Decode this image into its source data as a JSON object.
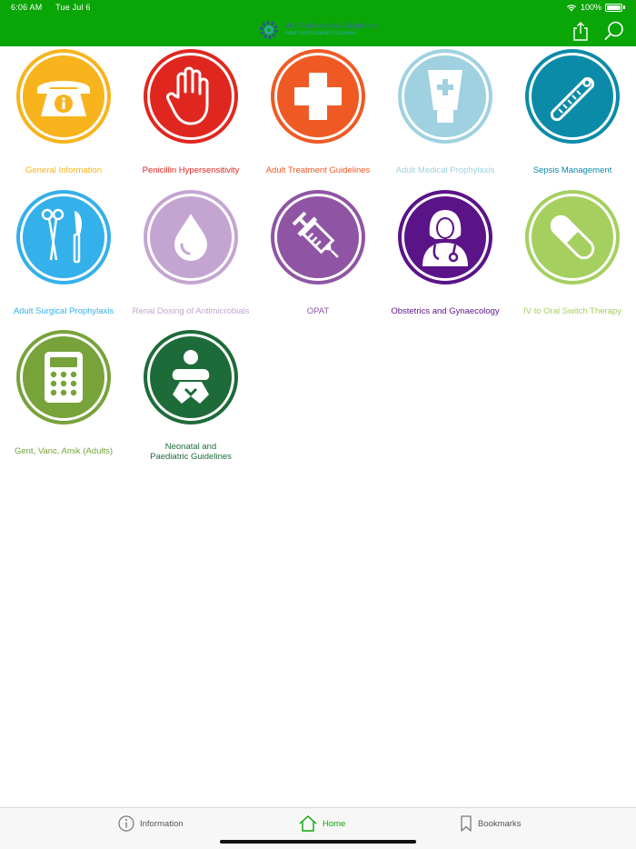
{
  "status": {
    "time": "6:06 AM",
    "date": "Tue Jul 6",
    "battery": "100%"
  },
  "header": {
    "logo_title": "UHL Antimicrobial Guidelines",
    "logo_subtitle": "Adult Antimicrobial Guidelines",
    "bg_color": "#0aa507"
  },
  "tiles": [
    {
      "label": "General Information",
      "color": "#f7b41c",
      "icon": "telephone-info-icon"
    },
    {
      "label": "Penicillin Hypersensitivity",
      "color": "#e0271f",
      "icon": "stop-hand-icon"
    },
    {
      "label": "Adult Treatment Guidelines",
      "color": "#ef5a24",
      "icon": "medical-cross-icon"
    },
    {
      "label": "Adult Medical Prophylaxis",
      "color": "#9fd1e0",
      "icon": "ointment-tube-icon"
    },
    {
      "label": "Sepsis Management",
      "color": "#0b8ba8",
      "icon": "thermometer-icon"
    },
    {
      "label": "Adult Surgical Prophylaxis",
      "color": "#34b0ea",
      "icon": "surgical-tools-icon"
    },
    {
      "label": "Renal Dosing of Antimicrobials",
      "color": "#c4a5d2",
      "icon": "water-drop-icon"
    },
    {
      "label": "OPAT",
      "color": "#8f55a4",
      "icon": "syringe-icon"
    },
    {
      "label": "Obstetrics and Gynaecology",
      "color": "#5b1388",
      "icon": "female-doctor-icon"
    },
    {
      "label": "IV to Oral Switch Therapy",
      "color": "#a5cf5f",
      "icon": "capsule-icon"
    },
    {
      "label": "Gent, Vanc, Amik (Adults)",
      "color": "#77a33a",
      "icon": "calculator-icon"
    },
    {
      "label": "Neonatal and Paediatric Guidelines",
      "label_line1": "Neonatal and",
      "label_line2": "Paediatric Guidelines",
      "color": "#1e6b3a",
      "icon": "baby-icon"
    }
  ],
  "tabbar": {
    "items": [
      {
        "label": "Information",
        "icon": "info-icon"
      },
      {
        "label": "Home",
        "icon": "home-icon",
        "active": true
      },
      {
        "label": "Bookmarks",
        "icon": "bookmark-icon"
      }
    ],
    "active_color": "#0aa507"
  }
}
